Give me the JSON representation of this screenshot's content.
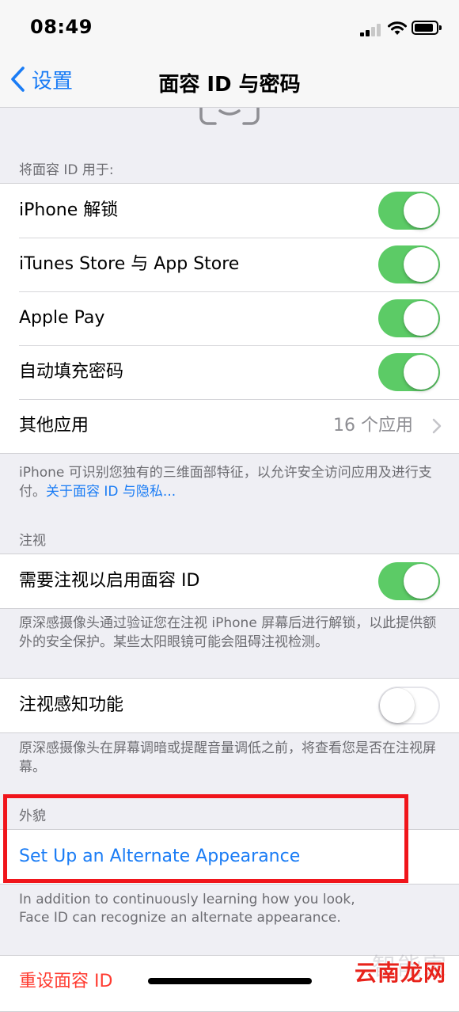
{
  "status_bar": {
    "time": "08:49"
  },
  "nav": {
    "back_label": "设置",
    "title": "面容 ID 与密码"
  },
  "use_for": {
    "header": "将面容 ID 用于:",
    "rows": [
      {
        "label": "iPhone 解锁",
        "enabled": true
      },
      {
        "label": "iTunes Store 与 App Store",
        "enabled": true
      },
      {
        "label": "Apple Pay",
        "enabled": true
      },
      {
        "label": "自动填充密码",
        "enabled": true
      }
    ],
    "other_apps": {
      "label": "其他应用",
      "detail": "16 个应用"
    },
    "footer": "iPhone 可识别您独有的三维面部特征，以允许安全访问应用及进行支付。",
    "footer_link": "关于面容 ID 与隐私..."
  },
  "attention": {
    "header": "注视",
    "require_label": "需要注视以启用面容 ID",
    "require_enabled": true,
    "require_footer": "原深感摄像头通过验证您在注视 iPhone 屏幕后进行解锁，以此提供额外的安全保护。某些太阳眼镜可能会阻碍注视检测。",
    "aware_label": "注视感知功能",
    "aware_enabled": false,
    "aware_footer": "原深感摄像头在屏幕调暗或提醒音量调低之前，将查看您是否在注视屏幕。"
  },
  "appearance": {
    "header": "外貌",
    "setup_label": "Set Up an Alternate Appearance",
    "footer": "In addition to continuously learning how you look, Face ID can recognize an alternate appearance."
  },
  "reset_label": "重设面容 ID",
  "watermark": {
    "faint": "智能家",
    "brand": "云南龙网"
  },
  "colors": {
    "accent": "#1a7cf5",
    "toggle_on": "#5ccb66",
    "destructive": "#ff3b30",
    "highlight_box": "#f0151b"
  }
}
